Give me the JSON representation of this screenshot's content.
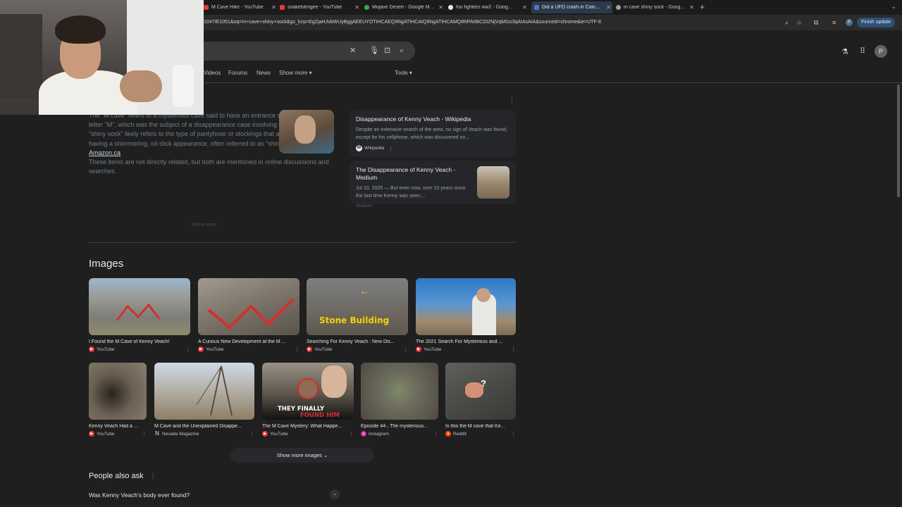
{
  "tabs": [
    {
      "title": "M Cave Hike - YouTube",
      "color": "#e53935"
    },
    {
      "title": "snakebitmgee - YouTube",
      "color": "#e53935"
    },
    {
      "title": "Mojave Desert - Google Maps",
      "color": "#34a853"
    },
    {
      "title": "foo fighters ww2 - Google Search",
      "color": "#4285f4"
    },
    {
      "title": "Did a UFO crash in Colombia?",
      "color": "#4d7ab3"
    },
    {
      "title": "m cave shiny sock - Google Search",
      "color": "#4285f4"
    }
  ],
  "url": "1047IE1051&oq=m+cave+shiny+sock&gs_lcrp=EgZjaHJvbWUyBggAEEUYOTIHCAEQIRigATIHCAIQIRigATIHCAMQIRiPAtIBCDI2NjVqMGo3qAIAsAIA&sourceid=chrome&ie=UTF-8",
  "profile_initial": "P",
  "finish_update": "Finish update",
  "nav": {
    "videos": "Videos",
    "forums": "Forums",
    "news": "News",
    "show_more": "Show more ▾",
    "tools": "Tools ▾"
  },
  "overview": {
    "p1": "The \"M cave\" refers to a mysterious cave said to have an entrance shaped like the letter \"M\", which was the subject of a disappearance case involving Kenny Veach. The \"shiny sock\" likely refers to the type of pantyhose or stockings that are described as having a shimmering, oil-slick appearance, often referred to as \"shiny\" or \"oil socks\"",
    "amazon": "on Amazon.ca",
    "p2": "These items are not directly related, but both are mentioned in online discussions and searches.",
    "show_more": "Show more"
  },
  "sources": [
    {
      "title": "Disappearance of Kenny Veach - Wikipedia",
      "snippet": "Despite an extensive search of the area, no sign of Veach was found, except for his cellphone, which was discovered on...",
      "site": "Wikipedia"
    },
    {
      "title": "The Disappearance of Kenny Veach - Medium",
      "snippet": "Jul 10, 2025 — But even now, over 10 years since the last time Kenny was seen,...",
      "site": "Medium"
    }
  ],
  "images_title": "Images",
  "images_row1": [
    {
      "caption": "I Found the M Cave of Kenny Veach!",
      "source": "YouTube"
    },
    {
      "caption": "A Curious New Development at the M ...",
      "source": "YouTube"
    },
    {
      "caption": "Searching For Kenny Veach : New Dis...",
      "source": "YouTube",
      "overlay": "Stone Building"
    },
    {
      "caption": "The 2021 Search For Mysterious and ...",
      "source": "YouTube"
    }
  ],
  "images_row2": [
    {
      "caption": "Kenny Veach Had a ...",
      "source": "YouTube"
    },
    {
      "caption": "M Cave and the Unexplained Disappe...",
      "source": "Nevada Magazine"
    },
    {
      "caption": "The M Cave Mystery: What Happe...",
      "source": "YouTube",
      "overlay1": "THEY FINALLY",
      "overlay2": "FOUND HIM"
    },
    {
      "caption": "Episode 44-, The mysterious...",
      "source": "Instagram"
    },
    {
      "caption": "Is this the M cave that Ke...",
      "source": "Reddit"
    }
  ],
  "show_more_images": "Show more images ⌄",
  "paa": {
    "title": "People also ask",
    "q1": "Was Kenny Veach's body ever found?"
  }
}
